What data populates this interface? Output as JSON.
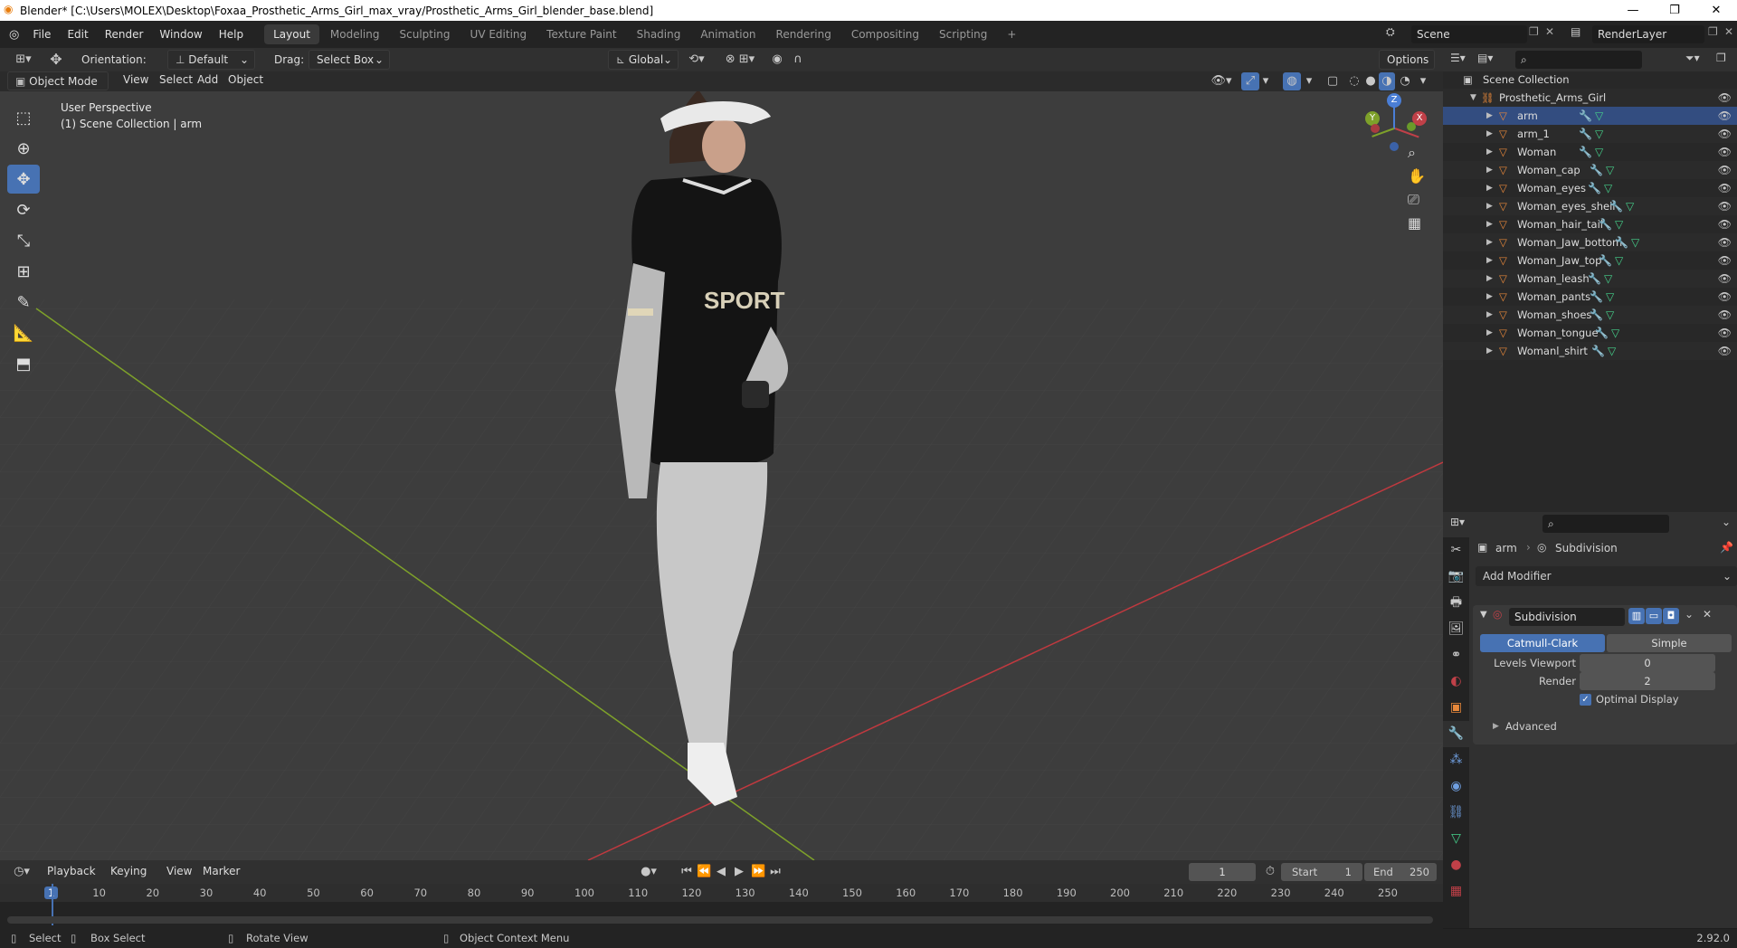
{
  "window": {
    "title": "Blender* [C:\\Users\\MOLEX\\Desktop\\Foxaa_Prosthetic_Arms_Girl_max_vray/Prosthetic_Arms_Girl_blender_base.blend]",
    "controls": [
      "—",
      "❐",
      "✕"
    ]
  },
  "menu": [
    "File",
    "Edit",
    "Render",
    "Window",
    "Help"
  ],
  "workspaces": [
    "Layout",
    "Modeling",
    "Sculpting",
    "UV Editing",
    "Texture Paint",
    "Shading",
    "Animation",
    "Rendering",
    "Compositing",
    "Scripting"
  ],
  "active_workspace": "Layout",
  "scene": "Scene",
  "view_layer": "RenderLayer",
  "tool_header": {
    "orientation_label": "Orientation:",
    "orientation_value": "Default",
    "drag_label": "Drag:",
    "drag_value": "Select Box",
    "transform_orientation": "Global",
    "options": "Options"
  },
  "viewport_header": {
    "mode": "Object Mode",
    "menus": [
      "View",
      "Select",
      "Add",
      "Object"
    ]
  },
  "viewport": {
    "perspective": "User Perspective",
    "collection": "(1) Scene Collection | arm",
    "gizmo": {
      "z": "Z",
      "y": "Y",
      "x": "X"
    }
  },
  "outliner": {
    "root": "Scene Collection",
    "collection": "Prosthetic_Arms_Girl",
    "objects": [
      "arm",
      "arm_1",
      "Woman",
      "Woman_cap",
      "Woman_eyes",
      "Woman_eyes_shell",
      "Woman_hair_tail",
      "Woman_Jaw_bottom",
      "Woman_Jaw_top",
      "Woman_leash",
      "Woman_pants",
      "Woman_shoes",
      "Woman_tongue",
      "Womanl_shirt"
    ]
  },
  "properties": {
    "object": "arm",
    "modifier_name": "Subdivision",
    "add_modifier": "Add Modifier",
    "panel_name": "Subdivision",
    "type_a": "Catmull-Clark",
    "type_b": "Simple",
    "levels_viewport_label": "Levels Viewport",
    "levels_viewport": "0",
    "render_label": "Render",
    "render": "2",
    "optimal_display": "Optimal Display",
    "advanced": "Advanced"
  },
  "timeline": {
    "menus": [
      "Playback",
      "Keying",
      "View",
      "Marker"
    ],
    "current_frame": "1",
    "start_label": "Start",
    "start": "1",
    "end_label": "End",
    "end": "250",
    "ticks": [
      "1",
      "10",
      "20",
      "30",
      "40",
      "50",
      "60",
      "70",
      "80",
      "90",
      "100",
      "110",
      "120",
      "130",
      "140",
      "150",
      "160",
      "170",
      "180",
      "190",
      "200",
      "210",
      "220",
      "230",
      "240",
      "250"
    ]
  },
  "statusbar": {
    "select": "Select",
    "box_select": "Box Select",
    "rotate_view": "Rotate View",
    "context_menu": "Object Context Menu",
    "version": "2.92.0"
  },
  "colors": {
    "accent": "#4772b3",
    "viewport_bg": "#3d3d3d",
    "object_orange": "#e8883a",
    "modifier_blue": "#6f9fe0",
    "mesh_green": "#45d18b"
  }
}
